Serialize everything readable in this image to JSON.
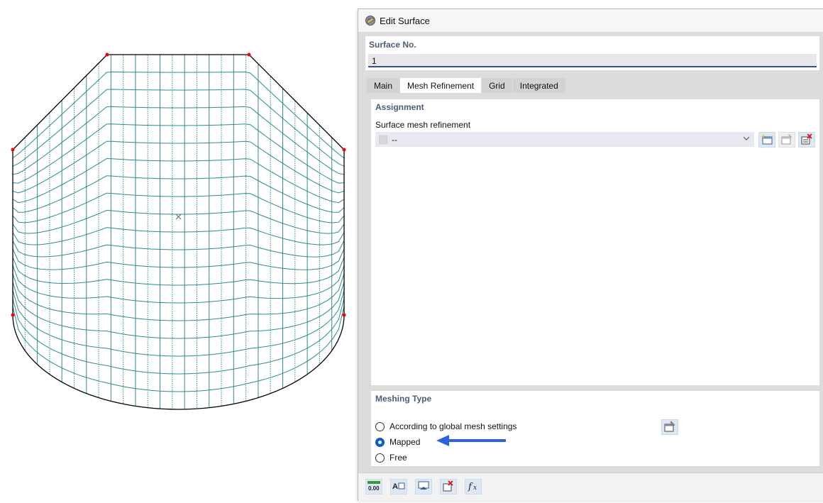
{
  "dialog": {
    "title": "Edit Surface",
    "surface_no_label": "Surface No.",
    "surface_no_value": "1"
  },
  "tabs": [
    {
      "label": "Main",
      "active": false
    },
    {
      "label": "Mesh Refinement",
      "active": true
    },
    {
      "label": "Grid",
      "active": false
    },
    {
      "label": "Integrated",
      "active": false
    }
  ],
  "assignment": {
    "title": "Assignment",
    "field_label": "Surface mesh refinement",
    "selected_value": "--",
    "buttons": [
      "new-item-icon",
      "edit-item-icon",
      "delete-item-icon"
    ]
  },
  "meshing_type": {
    "title": "Meshing Type",
    "options": [
      {
        "label": "According to global mesh settings",
        "selected": false
      },
      {
        "label": "Mapped",
        "selected": true
      },
      {
        "label": "Free",
        "selected": false
      }
    ],
    "settings_button_icon": "mesh-settings-icon"
  },
  "bottom_toolbar": [
    "units-icon",
    "text-format-icon",
    "view-icon",
    "delete-icon",
    "formula-icon"
  ],
  "colors": {
    "mesh_line": "#2e8b8b",
    "boundary": "#000000",
    "node": "#ff0000",
    "arrow": "#2d63e0",
    "section_title": "#4b5d78"
  }
}
